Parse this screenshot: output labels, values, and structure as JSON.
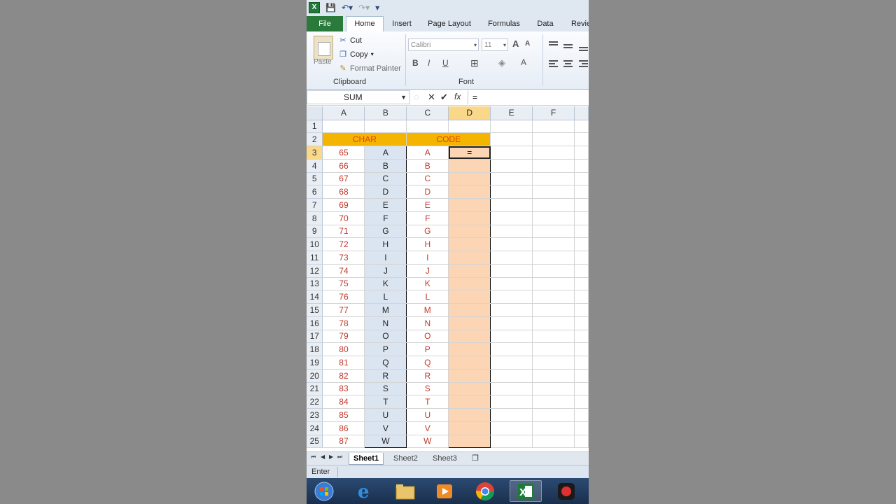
{
  "ribbon_tabs": [
    "File",
    "Home",
    "Insert",
    "Page Layout",
    "Formulas",
    "Data",
    "Revie"
  ],
  "clipboard": {
    "paste": "Paste",
    "cut": "Cut",
    "copy": "Copy",
    "format_painter": "Format Painter",
    "group_label": "Clipboard"
  },
  "font": {
    "name": "Calibri",
    "size": "11",
    "group_label": "Font",
    "bold": "B",
    "italic": "I",
    "underline": "U",
    "grow": "A",
    "color": "A"
  },
  "formula_bar": {
    "name_box": "SUM",
    "fx": "fx",
    "value": "="
  },
  "columns": [
    "A",
    "B",
    "C",
    "D",
    "E",
    "F"
  ],
  "rows": [
    "1",
    "2",
    "3",
    "4",
    "5",
    "6",
    "7",
    "8",
    "9",
    "10",
    "11",
    "12",
    "13",
    "14",
    "15",
    "16",
    "17",
    "18",
    "19",
    "20",
    "21",
    "22",
    "23",
    "24",
    "25"
  ],
  "headers": {
    "char": "CHAR",
    "code": "CODE"
  },
  "table": [
    {
      "a": "65",
      "b": "A",
      "c": "A"
    },
    {
      "a": "66",
      "b": "B",
      "c": "B"
    },
    {
      "a": "67",
      "b": "C",
      "c": "C"
    },
    {
      "a": "68",
      "b": "D",
      "c": "D"
    },
    {
      "a": "69",
      "b": "E",
      "c": "E"
    },
    {
      "a": "70",
      "b": "F",
      "c": "F"
    },
    {
      "a": "71",
      "b": "G",
      "c": "G"
    },
    {
      "a": "72",
      "b": "H",
      "c": "H"
    },
    {
      "a": "73",
      "b": "I",
      "c": "I"
    },
    {
      "a": "74",
      "b": "J",
      "c": "J"
    },
    {
      "a": "75",
      "b": "K",
      "c": "K"
    },
    {
      "a": "76",
      "b": "L",
      "c": "L"
    },
    {
      "a": "77",
      "b": "M",
      "c": "M"
    },
    {
      "a": "78",
      "b": "N",
      "c": "N"
    },
    {
      "a": "79",
      "b": "O",
      "c": "O"
    },
    {
      "a": "80",
      "b": "P",
      "c": "P"
    },
    {
      "a": "81",
      "b": "Q",
      "c": "Q"
    },
    {
      "a": "82",
      "b": "R",
      "c": "R"
    },
    {
      "a": "83",
      "b": "S",
      "c": "S"
    },
    {
      "a": "84",
      "b": "T",
      "c": "T"
    },
    {
      "a": "85",
      "b": "U",
      "c": "U"
    },
    {
      "a": "86",
      "b": "V",
      "c": "V"
    },
    {
      "a": "87",
      "b": "W",
      "c": "W"
    }
  ],
  "active_cell_value": "=",
  "sheets": [
    "Sheet1",
    "Sheet2",
    "Sheet3"
  ],
  "status": "Enter",
  "colors": {
    "header_fill": "#f5b400",
    "header_text": "#e04010",
    "code_fill": "#fcd5b4",
    "char_fill": "#dbe5f1",
    "number_text": "#c0392b"
  }
}
